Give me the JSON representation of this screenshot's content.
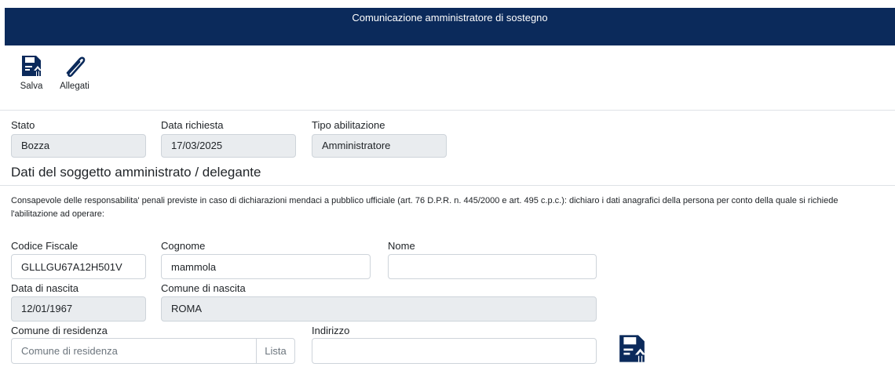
{
  "window": {
    "title": "Comunicazione amministratore di sostegno"
  },
  "toolbar": {
    "save_label": "Salva",
    "attachments_label": "Allegati"
  },
  "summary": {
    "stato": {
      "label": "Stato",
      "value": "Bozza"
    },
    "data_richiesta": {
      "label": "Data richiesta",
      "value": "17/03/2025"
    },
    "tipo_abilitazione": {
      "label": "Tipo abilitazione",
      "value": "Amministratore"
    }
  },
  "section": {
    "title": "Dati del soggetto amministrato / delegante",
    "note": "Consapevole delle responsabilita' penali previste in caso di dichiarazioni mendaci a pubblico ufficiale (art. 76 D.P.R. n. 445/2000 e art. 495 c.p.c.): dichiaro i dati anagrafici della persona per conto della quale si richiede l'abilitazione ad operare:"
  },
  "form": {
    "codice_fiscale": {
      "label": "Codice Fiscale",
      "value": "GLLLGU67A12H501V"
    },
    "cognome": {
      "label": "Cognome",
      "value": "mammola"
    },
    "nome": {
      "label": "Nome",
      "value": ""
    },
    "data_nascita": {
      "label": "Data di nascita",
      "value": "12/01/1967"
    },
    "comune_nascita": {
      "label": "Comune di nascita",
      "value": "ROMA"
    },
    "comune_residenza": {
      "label": "Comune di residenza",
      "value": "",
      "placeholder": "Comune di residenza",
      "button": "Lista"
    },
    "indirizzo": {
      "label": "Indirizzo",
      "value": ""
    }
  },
  "colors": {
    "header_bg": "#0b2a5b",
    "icon_color": "#0b2a5b",
    "readonly_bg": "#e9ecef"
  },
  "icons": [
    "save-icon",
    "paperclip-icon"
  ]
}
